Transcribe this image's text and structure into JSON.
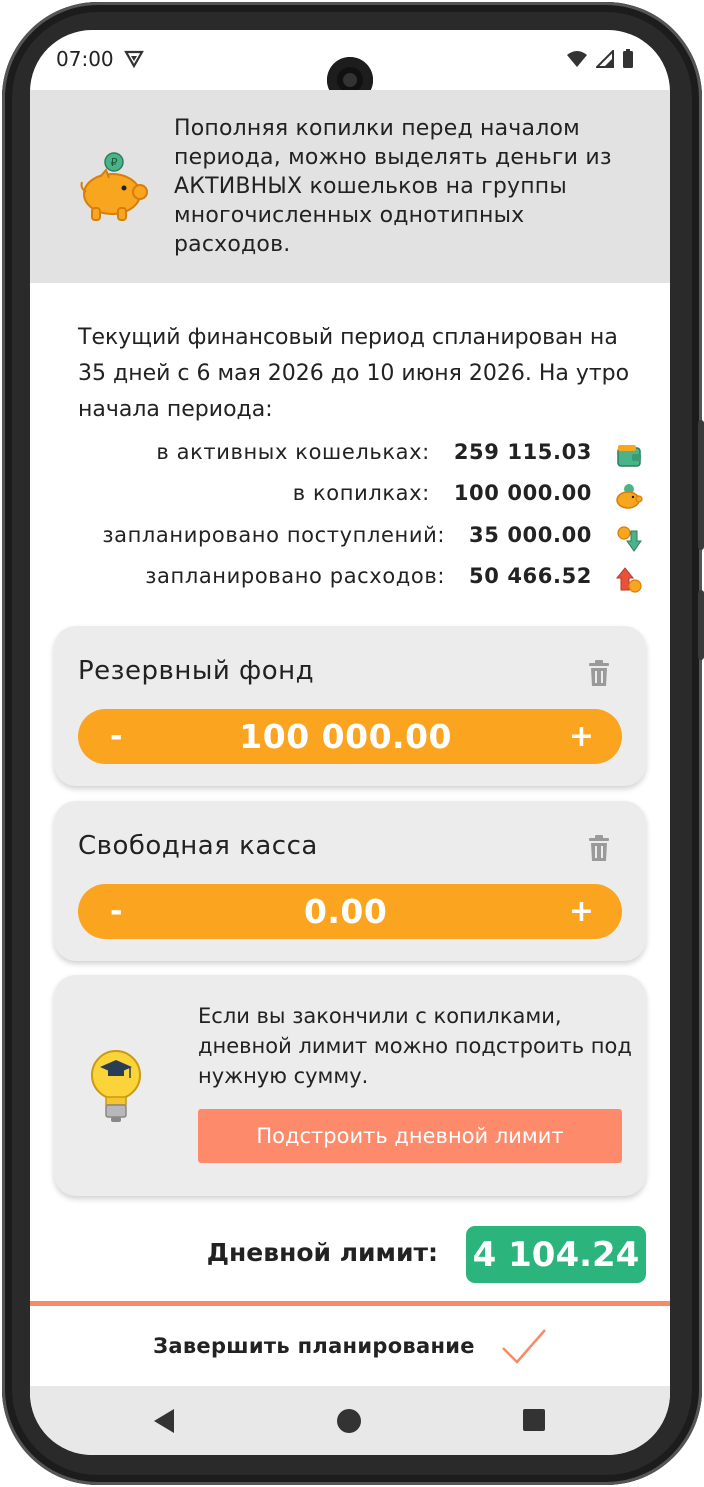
{
  "status_bar": {
    "time": "07:00"
  },
  "banner": {
    "text": "Пополняя копилки перед началом периода, можно выделять деньги из АКТИВНЫХ кошельков на группы многочисленных однотипных расходов."
  },
  "period": {
    "text": "Текущий финансовый период спланирован на 35 дней с 6 мая 2026 до 10 июня 2026. На утро начала периода:"
  },
  "stats": [
    {
      "label": "в активных кошельках:",
      "value": "259 115.03",
      "icon": "wallet-icon"
    },
    {
      "label": "в копилках:",
      "value": "100 000.00",
      "icon": "piggy-bank-icon"
    },
    {
      "label": "запланировано поступлений:",
      "value": "35 000.00",
      "icon": "income-arrow-icon"
    },
    {
      "label": "запланировано расходов:",
      "value": "50 466.52",
      "icon": "expense-arrow-icon"
    }
  ],
  "funds": [
    {
      "title": "Резервный фонд",
      "amount": "100 000.00",
      "minus": "-",
      "plus": "+"
    },
    {
      "title": "Свободная касса",
      "amount": "0.00",
      "minus": "-",
      "plus": "+"
    }
  ],
  "tip": {
    "text": "Если вы закончили с копилками, дневной лимит можно подстроить под нужную сумму.",
    "button_label": "Подстроить дневной лимит"
  },
  "daily_limit": {
    "label": "Дневной лимит:",
    "value": "4 104.24"
  },
  "finish": {
    "label": "Завершить планирование"
  },
  "colors": {
    "accent_orange": "#fba41f",
    "button_salmon": "#fd8b6b",
    "limit_green": "#2bb57d",
    "banner_gray": "#e2e2e2",
    "card_gray": "#ececec"
  }
}
